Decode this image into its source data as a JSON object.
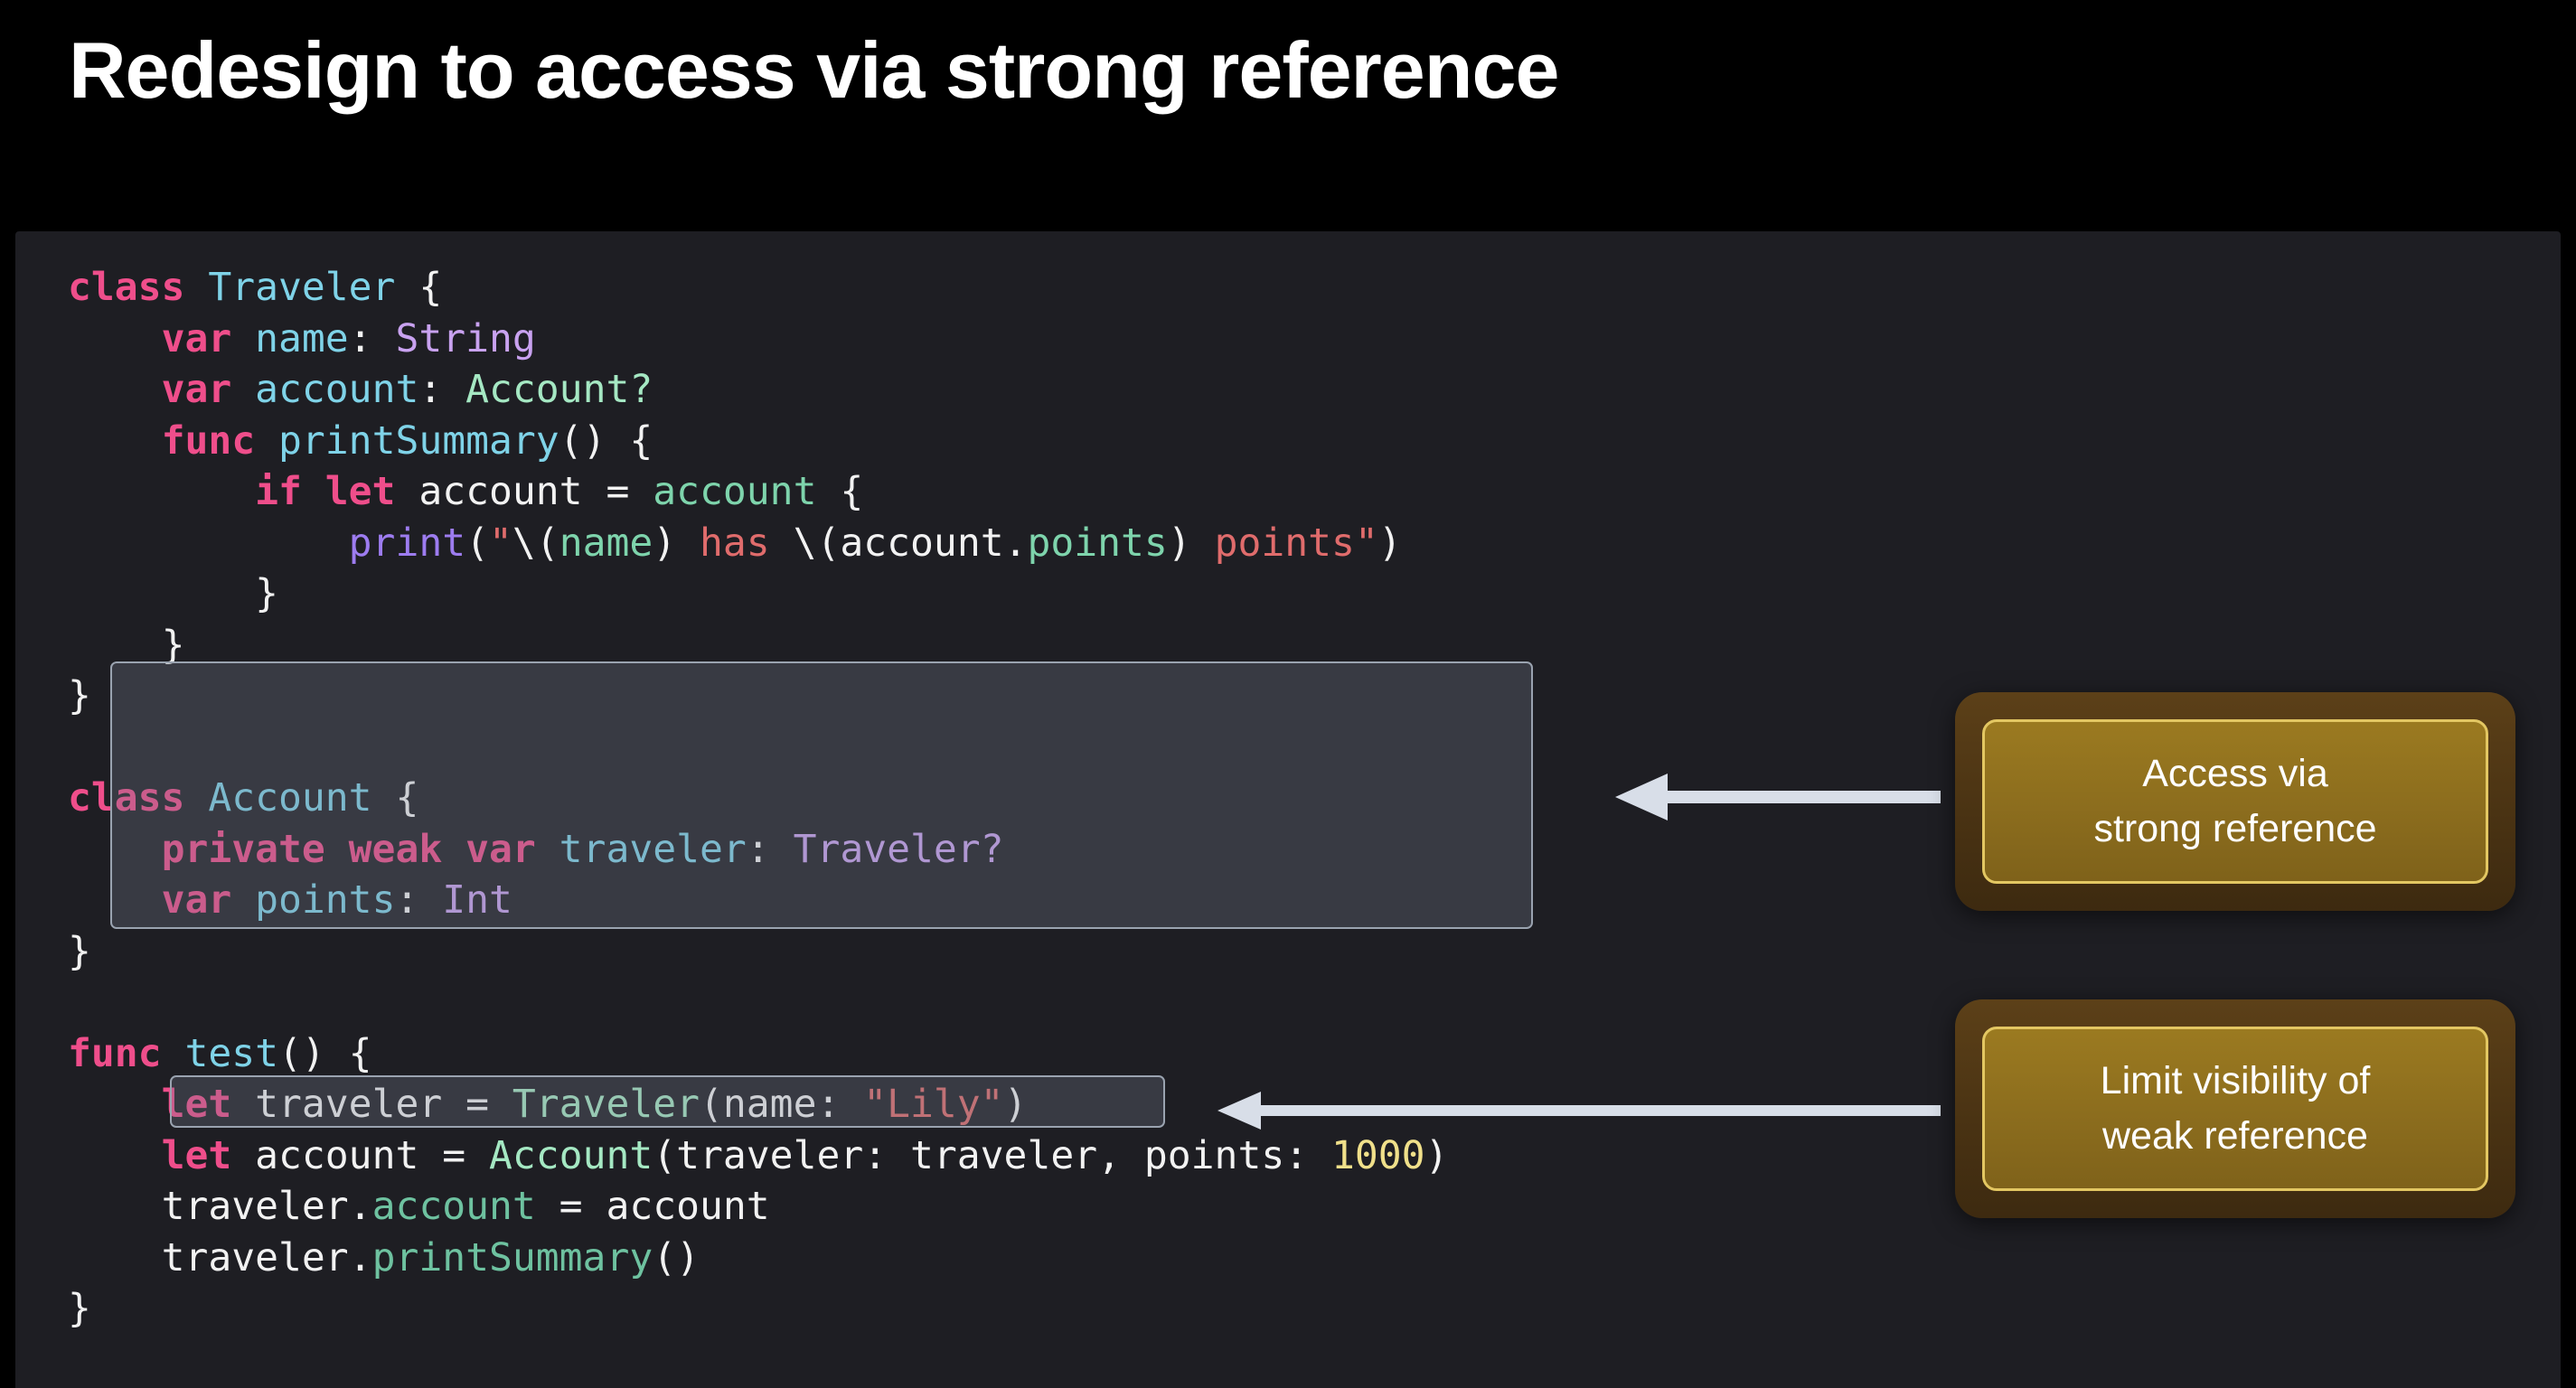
{
  "slide": {
    "title": "Redesign to access via strong reference",
    "background_color": "#000000",
    "code_panel_color": "#1e1e23"
  },
  "code": {
    "language": "Swift",
    "lines": [
      "class Traveler {",
      "    var name: String",
      "    var account: Account?",
      "    func printSummary() {",
      "        if let account = account {",
      "            print(\"\\(name) has \\(account.points) points\")",
      "        }",
      "    }",
      "}",
      "",
      "class Account {",
      "    private weak var traveler: Traveler?",
      "    var points: Int",
      "}",
      "",
      "func test() {",
      "    let traveler = Traveler(name: \"Lily\")",
      "    let account = Account(traveler: traveler, points: 1000)",
      "    traveler.account = account",
      "    traveler.printSummary()",
      "}"
    ],
    "tokens": {
      "l1": {
        "kw": "class",
        "type": "Traveler",
        "brace": " {"
      },
      "l2": {
        "indent": "    ",
        "kw": "var",
        "name": "name",
        "colon": ": ",
        "type": "String"
      },
      "l3": {
        "indent": "    ",
        "kw": "var",
        "name": "account",
        "colon": ": ",
        "type": "Account?"
      },
      "l4": {
        "indent": "    ",
        "kw": "func",
        "name": "printSummary",
        "rest": "() {"
      },
      "l5": {
        "indent": "        ",
        "kw1": "if",
        "kw2": "let",
        "name": "account",
        "eq": " = ",
        "value": "account",
        "brace": " {"
      },
      "l6": {
        "indent": "            ",
        "fn": "print",
        "open": "(",
        "quote": "\"",
        "interp1": "\\(",
        "var1": "name",
        "close1": ")",
        "text1": " has ",
        "interp2": "\\(",
        "var2": "account",
        "dot": ".",
        "prop": "points",
        "close2": ")",
        "text2": " points",
        "quote2": "\"",
        "close": ")"
      },
      "l7": {
        "indent": "        ",
        "brace": "}"
      },
      "l8": {
        "indent": "    ",
        "brace": "}"
      },
      "l9": {
        "brace": "}"
      },
      "l11": {
        "kw": "class",
        "type": "Account",
        "brace": " {"
      },
      "l12": {
        "indent": "    ",
        "kw": "private weak var",
        "name": "traveler",
        "colon": ": ",
        "type": "Traveler?"
      },
      "l13": {
        "indent": "    ",
        "kw": "var",
        "name": "points",
        "colon": ": ",
        "type": "Int"
      },
      "l14": {
        "brace": "}"
      },
      "l16": {
        "kw": "func",
        "name": "test",
        "rest": "() {"
      },
      "l17": {
        "indent": "    ",
        "kw": "let",
        "name": " traveler = ",
        "type": "Traveler",
        "open": "(name: ",
        "str": "\"Lily\"",
        "close": ")"
      },
      "l18": {
        "indent": "    ",
        "kw": "let",
        "name": " account = ",
        "type": "Account",
        "open": "(traveler: traveler, points: ",
        "num": "1000",
        "close": ")"
      },
      "l19": {
        "indent": "    ",
        "obj": "traveler",
        "dot": ".",
        "member": "account",
        "rest": " = account"
      },
      "l20": {
        "indent": "    ",
        "obj": "traveler",
        "dot": ".",
        "member": "printSummary",
        "rest": "()"
      },
      "l21": {
        "brace": "}"
      }
    },
    "syntax_colors": {
      "keyword": "#ef4e8b",
      "type_declaration": "#7fd3e8",
      "type_reference": "#c9a2f0",
      "constructor": "#a5e8c3",
      "member": "#6ec2a0",
      "interpolation": "#7ed4ac",
      "string": "#e06c6c",
      "builtin_function": "#9d7cf0",
      "number": "#f0e08a",
      "plain": "#f2f2f2"
    }
  },
  "highlights": [
    {
      "id": "printSummary-body",
      "label": "printSummary method highlight"
    },
    {
      "id": "weak-traveler-line",
      "label": "private weak var traveler highlight"
    }
  ],
  "callouts": [
    {
      "id": "callout-strong-reference",
      "text": "Access via\nstrong reference",
      "outer_color": "#4a3313",
      "inner_color": "#8d6e1e",
      "border_color": "#e3c762",
      "text_color": "#ffffff"
    },
    {
      "id": "callout-weak-reference",
      "text": "Limit visibility of\nweak reference",
      "outer_color": "#4a3313",
      "inner_color": "#8d6e1e",
      "border_color": "#e3c762",
      "text_color": "#ffffff"
    }
  ],
  "arrows": [
    {
      "id": "arrow-strong-reference",
      "direction": "left",
      "color": "#d8dee8"
    },
    {
      "id": "arrow-weak-reference",
      "direction": "left",
      "color": "#d8dee8"
    }
  ]
}
